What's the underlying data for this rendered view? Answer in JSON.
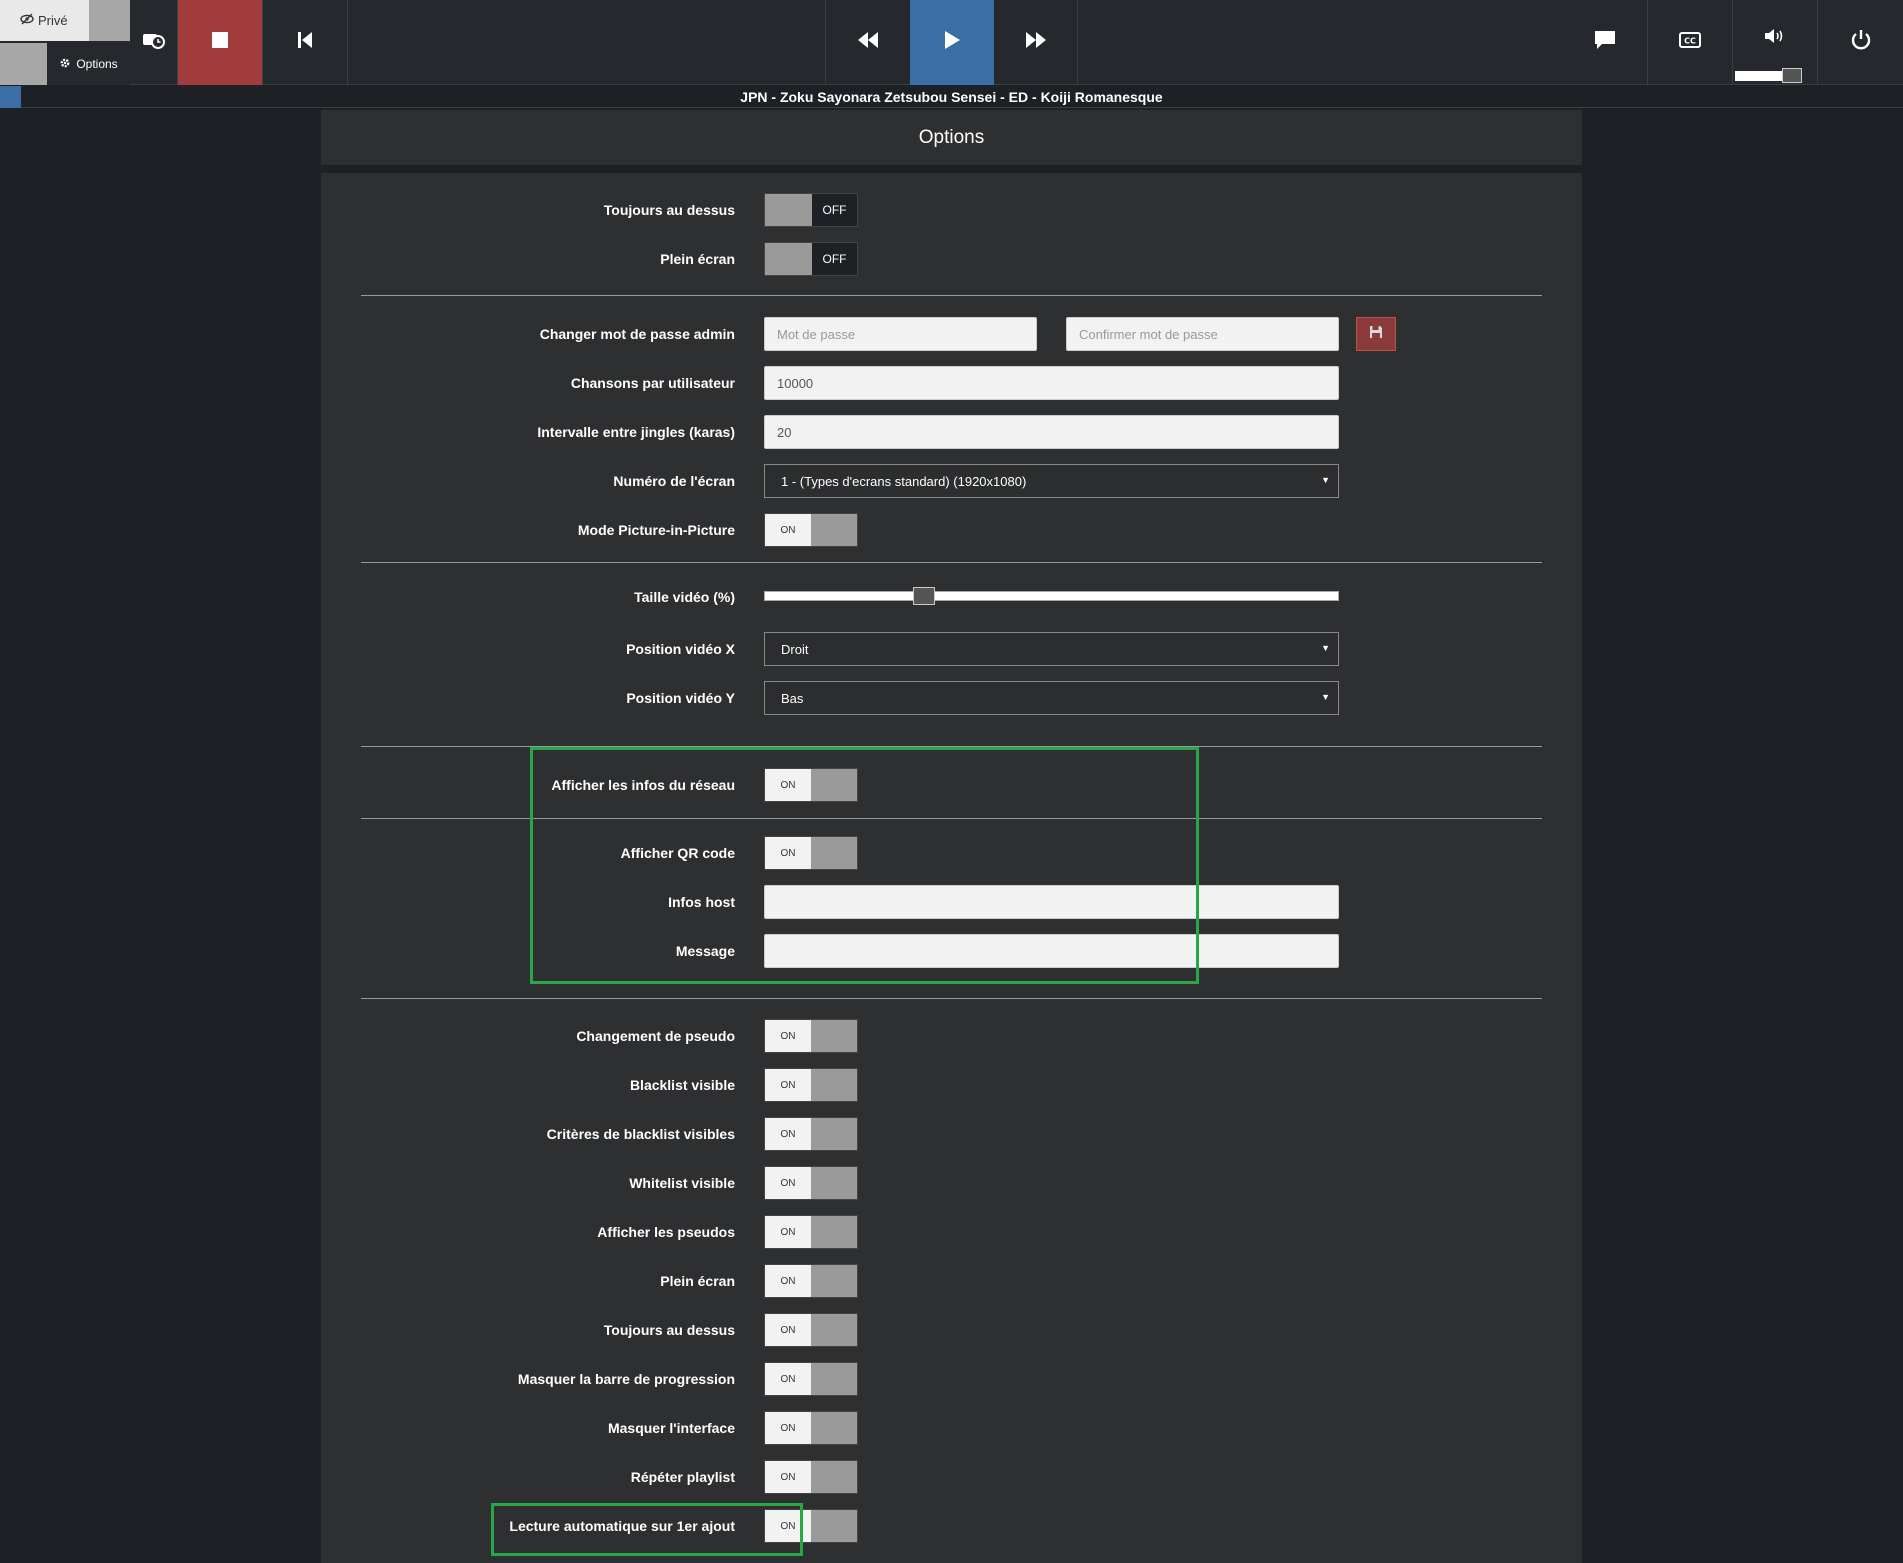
{
  "topbar": {
    "mode_private_label": "Privé",
    "mode_options_label": "Options"
  },
  "now_playing": {
    "title": "JPN - Zoku Sayonara Zetsubou Sensei - ED - Koiji Romanesque"
  },
  "options": {
    "header": "Options",
    "always_on_top": {
      "label": "Toujours au dessus",
      "state": "OFF"
    },
    "fullscreen": {
      "label": "Plein écran",
      "state": "OFF"
    },
    "admin_password": {
      "label": "Changer mot de passe admin",
      "password_placeholder": "Mot de passe",
      "confirm_placeholder": "Confirmer mot de passe"
    },
    "songs_per_user": {
      "label": "Chansons par utilisateur",
      "value": "10000"
    },
    "jingle_interval": {
      "label": "Intervalle entre jingles (karas)",
      "value": "20"
    },
    "screen_number": {
      "label": "Numéro de l'écran",
      "value": "1 - (Types d'ecrans standard) (1920x1080)"
    },
    "pip_mode": {
      "label": "Mode Picture-in-Picture",
      "state": "ON"
    },
    "video_size": {
      "label": "Taille vidéo (%)",
      "value_fraction": 0.27
    },
    "video_pos_x": {
      "label": "Position vidéo X",
      "value": "Droit"
    },
    "video_pos_y": {
      "label": "Position vidéo Y",
      "value": "Bas"
    },
    "network_info": {
      "label": "Afficher les infos du réseau",
      "state": "ON"
    },
    "qr_code": {
      "label": "Afficher QR code",
      "state": "ON"
    },
    "host_info": {
      "label": "Infos host",
      "value": ""
    },
    "message": {
      "label": "Message",
      "value": ""
    },
    "toggles": [
      {
        "label": "Changement de pseudo",
        "state": "ON"
      },
      {
        "label": "Blacklist visible",
        "state": "ON"
      },
      {
        "label": "Critères de blacklist visibles",
        "state": "ON"
      },
      {
        "label": "Whitelist visible",
        "state": "ON"
      },
      {
        "label": "Afficher les pseudos",
        "state": "ON"
      },
      {
        "label": "Plein écran",
        "state": "ON"
      },
      {
        "label": "Toujours au dessus",
        "state": "ON"
      },
      {
        "label": "Masquer la barre de progression",
        "state": "ON"
      },
      {
        "label": "Masquer l'interface",
        "state": "ON"
      },
      {
        "label": "Répéter playlist",
        "state": "ON"
      },
      {
        "label": "Lecture automatique sur 1er ajout",
        "state": "ON"
      }
    ]
  },
  "volume": {
    "level_fraction": 0.75
  },
  "colors": {
    "stop_button": "#a03c3c",
    "play_button": "#3b6ea5",
    "highlight": "#27a745"
  }
}
